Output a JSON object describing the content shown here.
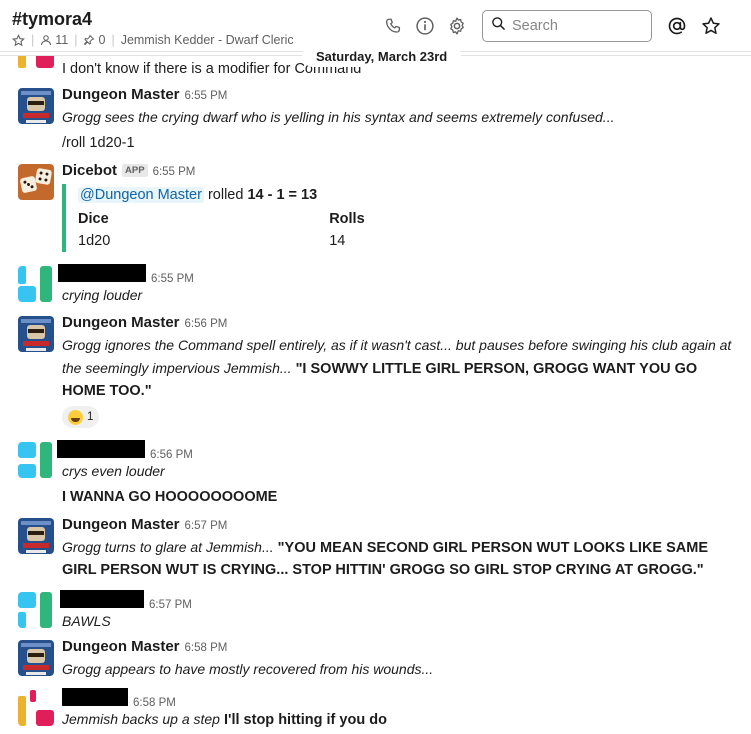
{
  "channel": {
    "name": "#tymora4",
    "members": "11",
    "pins": "0",
    "topic": "Jemmish Kedder - Dwarf Cleric"
  },
  "search": {
    "placeholder": "Search"
  },
  "date_divider": "Saturday, March 23rd",
  "messages": {
    "m0": {
      "text": "I don't know if there is a modifier for Command"
    },
    "m1": {
      "author": "Dungeon Master",
      "time": "6:55 PM",
      "text": "Grogg sees the crying dwarf who is yelling in his syntax and seems extremely confused...",
      "text2": "/roll 1d20-1"
    },
    "m2": {
      "author": "Dicebot",
      "badge": "APP",
      "time": "6:55 PM",
      "mention": "@Dungeon Master",
      "rolled_word": "rolled",
      "result": "14 - 1 = 13",
      "field1_title": "Dice",
      "field1_value": "1d20",
      "field2_title": "Rolls",
      "field2_value": "14"
    },
    "m3": {
      "time": "6:55 PM",
      "text": "crying louder"
    },
    "m4": {
      "author": "Dungeon Master",
      "time": "6:56 PM",
      "text": "Grogg ignores the Command spell entirely, as if it wasn't cast... but pauses before swinging his club again at the seemingly impervious Jemmish...",
      "bold_text": "\"I SOWWY LITTLE GIRL PERSON, GROGG WANT YOU GO HOME TOO.\"",
      "reaction_count": "1"
    },
    "m5": {
      "time": "6:56 PM",
      "text": "crys even louder",
      "text2": "I WANNA GO HOOOOOOOOME"
    },
    "m6": {
      "author": "Dungeon Master",
      "time": "6:57 PM",
      "text": "Grogg turns to glare at Jemmish...",
      "bold_text": "\"YOU MEAN SECOND GIRL PERSON WUT LOOKS LIKE SAME GIRL PERSON WUT IS CRYING... STOP HITTIN' GROGG SO GIRL STOP CRYING AT GROGG.\""
    },
    "m7": {
      "time": "6:57 PM",
      "text": "BAWLS"
    },
    "m8": {
      "author": "Dungeon Master",
      "time": "6:58 PM",
      "text": "Grogg appears to have mostly recovered from his wounds..."
    },
    "m9": {
      "time": "6:58 PM",
      "text": "Jemmish backs up a step",
      "bold_text": "I'll stop hitting if you do"
    }
  },
  "colors": {
    "slack_green": "#2eb67d",
    "slack_blue": "#36c5f0",
    "slack_red": "#e01e5a",
    "slack_yellow": "#ecb22e",
    "link": "#1264a3"
  },
  "icons": [
    "star-icon",
    "members-icon",
    "pin-icon",
    "phone-icon",
    "info-icon",
    "gear-icon",
    "search-icon",
    "mention-icon",
    "star-icon"
  ]
}
